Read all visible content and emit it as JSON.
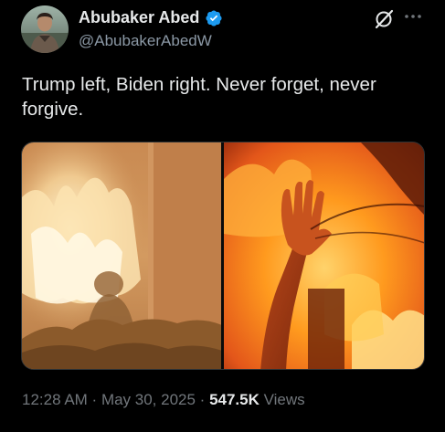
{
  "author": {
    "name": "Abubaker Abed",
    "handle": "@AbubakerAbedW",
    "verified": true,
    "avatar_icon": "profile-photo"
  },
  "header_actions": {
    "grok_icon": "grok-icon",
    "more_icon": "more-horizontal-icon"
  },
  "tweet": {
    "text": "Trump left, Biden right. Never forget, never forgive."
  },
  "media": {
    "left_image": "fire-scene-left",
    "right_image": "fire-scene-right-raised-hand"
  },
  "meta": {
    "time": "12:28 AM",
    "separator1": " · ",
    "date": "May 30, 2025",
    "separator2": " · ",
    "views_count": "547.5K",
    "views_label": " Views"
  },
  "colors": {
    "background": "#000000",
    "text_primary": "#e7e9ea",
    "text_secondary": "#71767b",
    "verified_badge": "#1d9bf0"
  }
}
